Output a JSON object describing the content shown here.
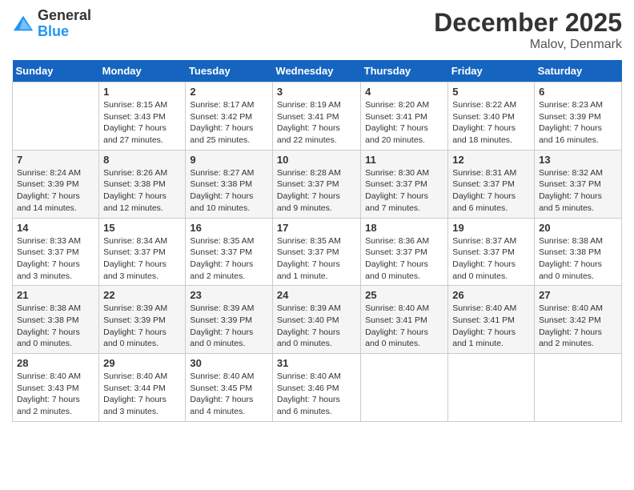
{
  "header": {
    "logo": {
      "line1": "General",
      "line2": "Blue"
    },
    "title": "December 2025",
    "subtitle": "Malov, Denmark"
  },
  "calendar": {
    "days_of_week": [
      "Sunday",
      "Monday",
      "Tuesday",
      "Wednesday",
      "Thursday",
      "Friday",
      "Saturday"
    ],
    "weeks": [
      [
        {
          "day": "",
          "content": ""
        },
        {
          "day": "1",
          "content": "Sunrise: 8:15 AM\nSunset: 3:43 PM\nDaylight: 7 hours\nand 27 minutes."
        },
        {
          "day": "2",
          "content": "Sunrise: 8:17 AM\nSunset: 3:42 PM\nDaylight: 7 hours\nand 25 minutes."
        },
        {
          "day": "3",
          "content": "Sunrise: 8:19 AM\nSunset: 3:41 PM\nDaylight: 7 hours\nand 22 minutes."
        },
        {
          "day": "4",
          "content": "Sunrise: 8:20 AM\nSunset: 3:41 PM\nDaylight: 7 hours\nand 20 minutes."
        },
        {
          "day": "5",
          "content": "Sunrise: 8:22 AM\nSunset: 3:40 PM\nDaylight: 7 hours\nand 18 minutes."
        },
        {
          "day": "6",
          "content": "Sunrise: 8:23 AM\nSunset: 3:39 PM\nDaylight: 7 hours\nand 16 minutes."
        }
      ],
      [
        {
          "day": "7",
          "content": "Sunrise: 8:24 AM\nSunset: 3:39 PM\nDaylight: 7 hours\nand 14 minutes."
        },
        {
          "day": "8",
          "content": "Sunrise: 8:26 AM\nSunset: 3:38 PM\nDaylight: 7 hours\nand 12 minutes."
        },
        {
          "day": "9",
          "content": "Sunrise: 8:27 AM\nSunset: 3:38 PM\nDaylight: 7 hours\nand 10 minutes."
        },
        {
          "day": "10",
          "content": "Sunrise: 8:28 AM\nSunset: 3:37 PM\nDaylight: 7 hours\nand 9 minutes."
        },
        {
          "day": "11",
          "content": "Sunrise: 8:30 AM\nSunset: 3:37 PM\nDaylight: 7 hours\nand 7 minutes."
        },
        {
          "day": "12",
          "content": "Sunrise: 8:31 AM\nSunset: 3:37 PM\nDaylight: 7 hours\nand 6 minutes."
        },
        {
          "day": "13",
          "content": "Sunrise: 8:32 AM\nSunset: 3:37 PM\nDaylight: 7 hours\nand 5 minutes."
        }
      ],
      [
        {
          "day": "14",
          "content": "Sunrise: 8:33 AM\nSunset: 3:37 PM\nDaylight: 7 hours\nand 3 minutes."
        },
        {
          "day": "15",
          "content": "Sunrise: 8:34 AM\nSunset: 3:37 PM\nDaylight: 7 hours\nand 3 minutes."
        },
        {
          "day": "16",
          "content": "Sunrise: 8:35 AM\nSunset: 3:37 PM\nDaylight: 7 hours\nand 2 minutes."
        },
        {
          "day": "17",
          "content": "Sunrise: 8:35 AM\nSunset: 3:37 PM\nDaylight: 7 hours\nand 1 minute."
        },
        {
          "day": "18",
          "content": "Sunrise: 8:36 AM\nSunset: 3:37 PM\nDaylight: 7 hours\nand 0 minutes."
        },
        {
          "day": "19",
          "content": "Sunrise: 8:37 AM\nSunset: 3:37 PM\nDaylight: 7 hours\nand 0 minutes."
        },
        {
          "day": "20",
          "content": "Sunrise: 8:38 AM\nSunset: 3:38 PM\nDaylight: 7 hours\nand 0 minutes."
        }
      ],
      [
        {
          "day": "21",
          "content": "Sunrise: 8:38 AM\nSunset: 3:38 PM\nDaylight: 7 hours\nand 0 minutes."
        },
        {
          "day": "22",
          "content": "Sunrise: 8:39 AM\nSunset: 3:39 PM\nDaylight: 7 hours\nand 0 minutes."
        },
        {
          "day": "23",
          "content": "Sunrise: 8:39 AM\nSunset: 3:39 PM\nDaylight: 7 hours\nand 0 minutes."
        },
        {
          "day": "24",
          "content": "Sunrise: 8:39 AM\nSunset: 3:40 PM\nDaylight: 7 hours\nand 0 minutes."
        },
        {
          "day": "25",
          "content": "Sunrise: 8:40 AM\nSunset: 3:41 PM\nDaylight: 7 hours\nand 0 minutes."
        },
        {
          "day": "26",
          "content": "Sunrise: 8:40 AM\nSunset: 3:41 PM\nDaylight: 7 hours\nand 1 minute."
        },
        {
          "day": "27",
          "content": "Sunrise: 8:40 AM\nSunset: 3:42 PM\nDaylight: 7 hours\nand 2 minutes."
        }
      ],
      [
        {
          "day": "28",
          "content": "Sunrise: 8:40 AM\nSunset: 3:43 PM\nDaylight: 7 hours\nand 2 minutes."
        },
        {
          "day": "29",
          "content": "Sunrise: 8:40 AM\nSunset: 3:44 PM\nDaylight: 7 hours\nand 3 minutes."
        },
        {
          "day": "30",
          "content": "Sunrise: 8:40 AM\nSunset: 3:45 PM\nDaylight: 7 hours\nand 4 minutes."
        },
        {
          "day": "31",
          "content": "Sunrise: 8:40 AM\nSunset: 3:46 PM\nDaylight: 7 hours\nand 6 minutes."
        },
        {
          "day": "",
          "content": ""
        },
        {
          "day": "",
          "content": ""
        },
        {
          "day": "",
          "content": ""
        }
      ]
    ]
  }
}
